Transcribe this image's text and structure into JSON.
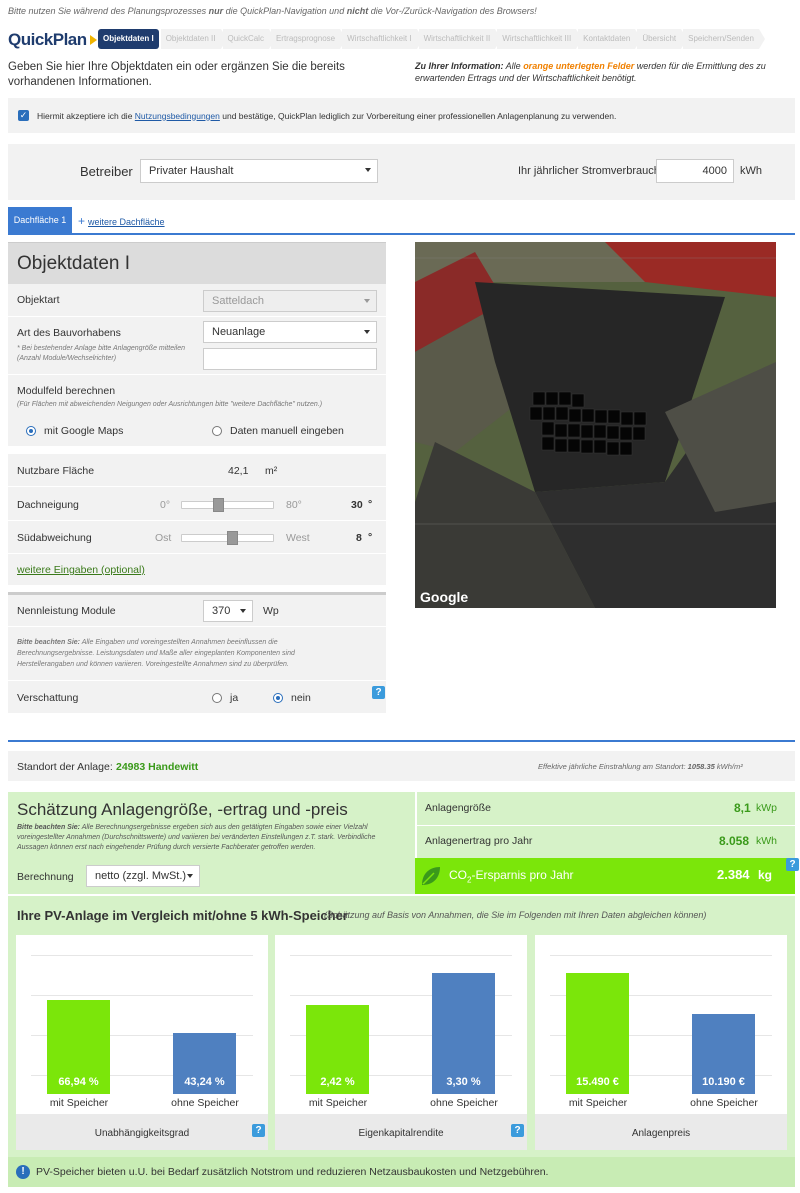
{
  "top_note": {
    "pre": "Bitte nutzen Sie während des Planungsprozesses ",
    "b1": "nur",
    "mid": " die QuickPlan-Navigation und ",
    "b2": "nicht",
    "post": " die Vor-/Zurück-Navigation des Browsers!"
  },
  "logo": {
    "text": "QuickPlan"
  },
  "steps": [
    "Objektdaten I",
    "Objektdaten II",
    "QuickCalc",
    "Ertragsprognose",
    "Wirtschaftlichkeit I",
    "Wirtschaftlichkeit II",
    "Wirtschaftlichkeit III",
    "Kontaktdaten",
    "Übersicht",
    "Speichern/Senden"
  ],
  "intro": "Geben Sie hier Ihre Objektdaten ein oder ergänzen Sie die bereits vorhandenen Informationen.",
  "info": {
    "b": "Zu Ihrer Information:",
    "pre": " Alle ",
    "orange": "orange unterlegten Felder",
    "post": " werden für die Ermittlung des zu erwartenden Ertrags und der Wirtschaftlichkeit benötigt."
  },
  "accept": {
    "pre": "Hiermit akzeptiere ich die ",
    "link": "Nutzungsbedingungen",
    "post": " und bestätige, QuickPlan lediglich zur Vorbereitung einer professionellen Anlagenplanung zu verwenden."
  },
  "betreiber": {
    "label": "Betreiber",
    "value": "Privater Haushalt",
    "verbrauch_label": "Ihr jährlicher Stromverbrauch",
    "verbrauch": "4000",
    "unit": "kWh"
  },
  "tabs": {
    "active": "Dachfläche 1",
    "add": "weitere Dachfläche"
  },
  "obj": {
    "title": "Objektdaten I",
    "objektart_label": "Objektart",
    "objektart": "Satteldach",
    "bau_label": "Art des Bauvorhabens",
    "bau": "Neuanlage",
    "bau_note": "* Bei bestehender Anlage bitte Anlagengröße mitteilen (Anzahl Module/Wechselrichter)",
    "modul_label": "Modulfeld berechnen",
    "modul_note": "(Für Flächen mit abweichenden Neigungen oder Ausrichtungen bitte \"weitere Dachfläche\" nutzen.)",
    "opt1": "mit Google Maps",
    "opt2": "Daten manuell eingeben",
    "flaeche_label": "Nutzbare Fläche",
    "flaeche": "42,1",
    "flaeche_unit": "m²",
    "neigung_label": "Dachneigung",
    "neigung_min": "0°",
    "neigung_max": "80°",
    "neigung": "30",
    "neigung_pos": 0.375,
    "sued_label": "Südabweichung",
    "sued_min": "Ost",
    "sued_max": "West",
    "sued": "8",
    "sued_pos": 0.55,
    "deg": "°",
    "weitere": "weitere Eingaben (optional)",
    "nenn_label": "Nennleistung Module",
    "nenn": "370",
    "nenn_unit": "Wp",
    "beachten_b": "Bitte beachten Sie:",
    "beachten": " Alle Eingaben und voreingestellten Annahmen beeinflussen die Berechnungsergebnisse. Leistungsdaten und Maße aller eingeplanten Komponenten sind Herstellerangaben und können variieren. Voreingestellte Annahmen sind zu überprüfen.",
    "versch_label": "Verschattung",
    "ja": "ja",
    "nein": "nein"
  },
  "map": {
    "brand": "Google"
  },
  "help": "?",
  "standort": {
    "label": "Standort der Anlage:",
    "value": "24983 Handewitt",
    "einstr_pre": "Effektive jährliche Einstrahlung am Standort: ",
    "einstr": "1058.35",
    "einstr_unit": " kWh/m²"
  },
  "est": {
    "title": "Schätzung Anlagengröße, -ertrag und -preis",
    "note_b": "Bitte beachten Sie:",
    "note": " Alle Berechnungsergebnisse ergeben sich aus den getätigten Eingaben sowie einer Vielzahl voreingestellter Annahmen (Durchschnittswerte) und variieren bei veränderten Einstellungen z.T. stark. Verbindliche Aussagen können erst nach eingehender Prüfung durch versierte Fachberater getroffen werden.",
    "ber_label": "Berechnung",
    "ber": "netto (zzgl. MwSt.)",
    "groesse_label": "Anlagengröße",
    "groesse": "8,1",
    "groesse_unit": "kWp",
    "ertrag_label": "Anlagenertrag pro Jahr",
    "ertrag": "8.058",
    "ertrag_unit": "kWh",
    "co2_label_pre": "CO",
    "co2_sub": "2",
    "co2_label_post": "-Ersparnis pro Jahr",
    "co2": "2.384",
    "co2_unit": "kg"
  },
  "cmp": {
    "title": "Ihre PV-Anlage im Vergleich mit/ohne 5 kWh-Speicher",
    "subtitle": "(Schätzung auf Basis von Annahmen, die Sie im Folgenden mit Ihren Daten abgleichen können)",
    "with": "mit Speicher",
    "without": "ohne Speicher",
    "footer": "PV-Speicher bieten u.U. bei Bedarf zusätzlich Notstrom und reduzieren Netzausbaukosten und Netzgebühren."
  },
  "colors": {
    "green": "#7be60a",
    "blue": "#4f80c0",
    "navy": "#1f3c6e",
    "accent": "#3b7ad1"
  },
  "chart_data": [
    {
      "type": "bar",
      "title": "Unabhängigkeitsgrad",
      "categories": [
        "mit Speicher",
        "ohne Speicher"
      ],
      "values": [
        66.94,
        43.24
      ],
      "labels": [
        "66,94 %",
        "43,24 %"
      ],
      "ylim": [
        0,
        100
      ]
    },
    {
      "type": "bar",
      "title": "Eigenkapitalrendite",
      "categories": [
        "mit Speicher",
        "ohne Speicher"
      ],
      "values": [
        2.42,
        3.3
      ],
      "labels": [
        "2,42 %",
        "3,30 %"
      ],
      "ylim": [
        0,
        3.82
      ]
    },
    {
      "type": "bar",
      "title": "Anlagenpreis",
      "categories": [
        "mit Speicher",
        "ohne Speicher"
      ],
      "values": [
        15490,
        10190
      ],
      "labels": [
        "15.490 €",
        "10.190 €"
      ],
      "ylim": [
        0,
        17900
      ]
    }
  ]
}
